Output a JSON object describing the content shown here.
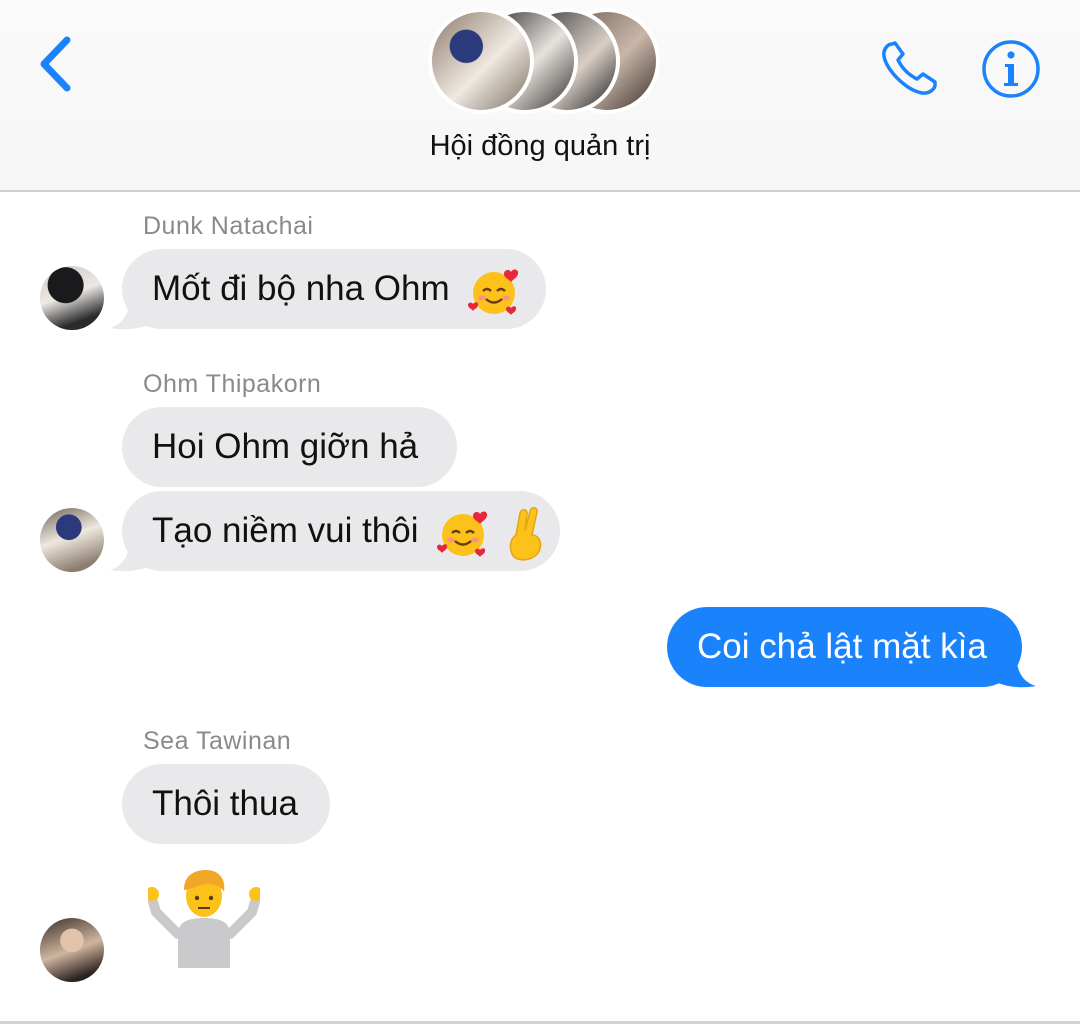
{
  "header": {
    "title": "Hội đồng quản trị",
    "back_icon": "chevron-left-icon",
    "call_icon": "phone-icon",
    "info_icon": "info-icon",
    "accent": "#1a82fb"
  },
  "messages": [
    {
      "sender": "Dunk Natachai",
      "text": "Mốt đi bộ nha Ohm",
      "emoji": [
        "smiling-face-with-hearts"
      ]
    },
    {
      "sender": "Ohm Thipakorn",
      "text": "Hoi Ohm giỡn hả"
    },
    {
      "text": "Tạo niềm vui thôi",
      "emoji": [
        "smiling-face-with-hearts",
        "crossed-fingers"
      ]
    },
    {
      "outgoing": true,
      "text": "Coi chả lật mặt kìa"
    },
    {
      "sender": "Sea Tawinan",
      "text": "Thôi thua"
    },
    {
      "emoji": [
        "person-shrugging"
      ]
    }
  ],
  "colors": {
    "incoming_bubble": "#e9e9eb",
    "outgoing_bubble": "#1a82fb",
    "sender_name": "#8a8a8e"
  }
}
